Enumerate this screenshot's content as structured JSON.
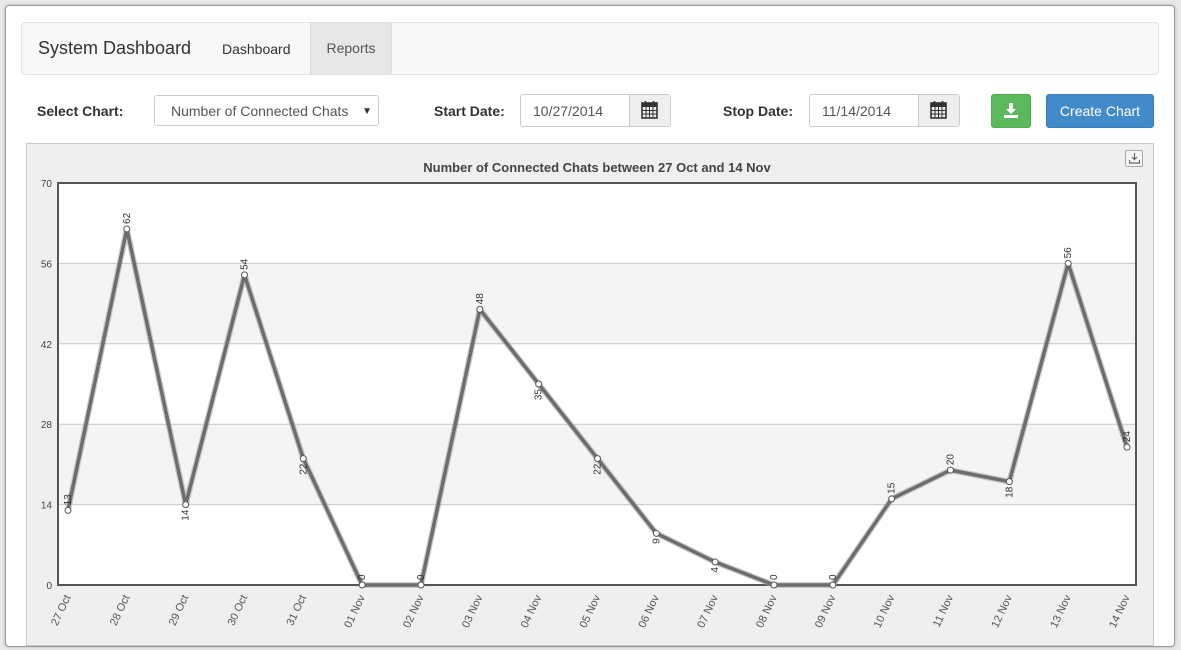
{
  "header": {
    "brand": "System Dashboard",
    "nav": [
      {
        "label": "Dashboard"
      },
      {
        "label": "Reports",
        "active": true
      }
    ]
  },
  "controls": {
    "select_chart_label": "Select Chart:",
    "select_chart_value": "Number of Connected Chats",
    "start_date_label": "Start Date:",
    "start_date_value": "10/27/2014",
    "stop_date_label": "Stop Date:",
    "stop_date_value": "11/14/2014",
    "download_icon": "download-icon",
    "calendar_icon": "calendar-icon",
    "create_button_label": "Create Chart"
  },
  "colors": {
    "line": "#6d6d6d",
    "download_button": "#5cb85c",
    "create_button": "#428bca",
    "plot_band": "#f4f4f4"
  },
  "chart_data": {
    "type": "line",
    "title": "Number of Connected Chats between 27 Oct and 14 Nov",
    "categories": [
      "27 Oct",
      "28 Oct",
      "29 Oct",
      "30 Oct",
      "31 Oct",
      "01 Nov",
      "02 Nov",
      "03 Nov",
      "04 Nov",
      "05 Nov",
      "06 Nov",
      "07 Nov",
      "08 Nov",
      "09 Nov",
      "10 Nov",
      "11 Nov",
      "12 Nov",
      "13 Nov",
      "14 Nov"
    ],
    "values": [
      13,
      62,
      14,
      54,
      22,
      0,
      0,
      48,
      35,
      22,
      9,
      4,
      0,
      0,
      15,
      20,
      18,
      56,
      24
    ],
    "ylim": [
      0,
      70
    ],
    "yticks": [
      0,
      14,
      28,
      42,
      56,
      70
    ],
    "grid": true,
    "legend": "none"
  }
}
